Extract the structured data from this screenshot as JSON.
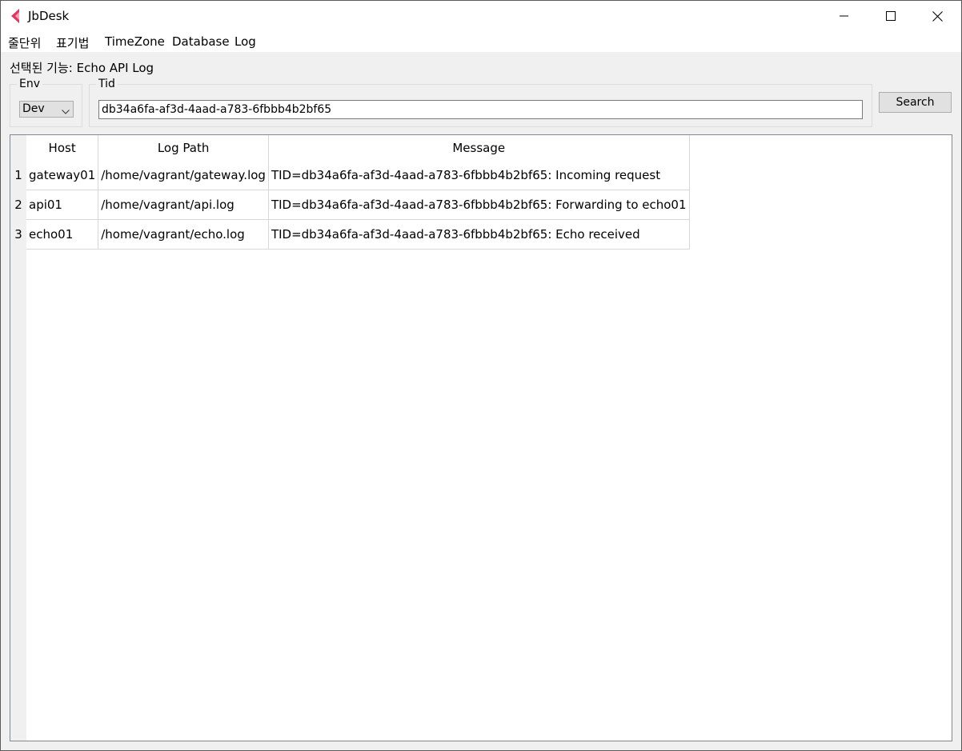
{
  "window": {
    "title": "JbDesk"
  },
  "menu": {
    "items": [
      "줄단위",
      "표기법",
      "TimeZone",
      "Database",
      "Log"
    ]
  },
  "selected_feature": "선택된 기능: Echo API Log",
  "env": {
    "legend": "Env",
    "selected": "Dev"
  },
  "tid": {
    "legend": "Tid",
    "value": "db34a6fa-af3d-4aad-a783-6fbbb4b2bf65"
  },
  "search_label": "Search",
  "table": {
    "columns": [
      "Host",
      "Log Path",
      "Message"
    ],
    "rows": [
      {
        "num": "1",
        "host": "gateway01",
        "path": "/home/vagrant/gateway.log",
        "message": "TID=db34a6fa-af3d-4aad-a783-6fbbb4b2bf65: Incoming request"
      },
      {
        "num": "2",
        "host": "api01",
        "path": "/home/vagrant/api.log",
        "message": "TID=db34a6fa-af3d-4aad-a783-6fbbb4b2bf65: Forwarding to echo01"
      },
      {
        "num": "3",
        "host": "echo01",
        "path": "/home/vagrant/echo.log",
        "message": "TID=db34a6fa-af3d-4aad-a783-6fbbb4b2bf65: Echo received"
      }
    ]
  },
  "colors": {
    "app_icon_primary": "#e8335f",
    "app_icon_secondary": "#f7a1b6",
    "window_bg": "#f0f0f0",
    "grid_line": "#d8d8d8"
  },
  "icons": {
    "app": "app-logo-icon",
    "minimize": "minimize-icon",
    "maximize": "maximize-icon",
    "close": "close-icon",
    "dropdown": "chevron-down-icon"
  }
}
